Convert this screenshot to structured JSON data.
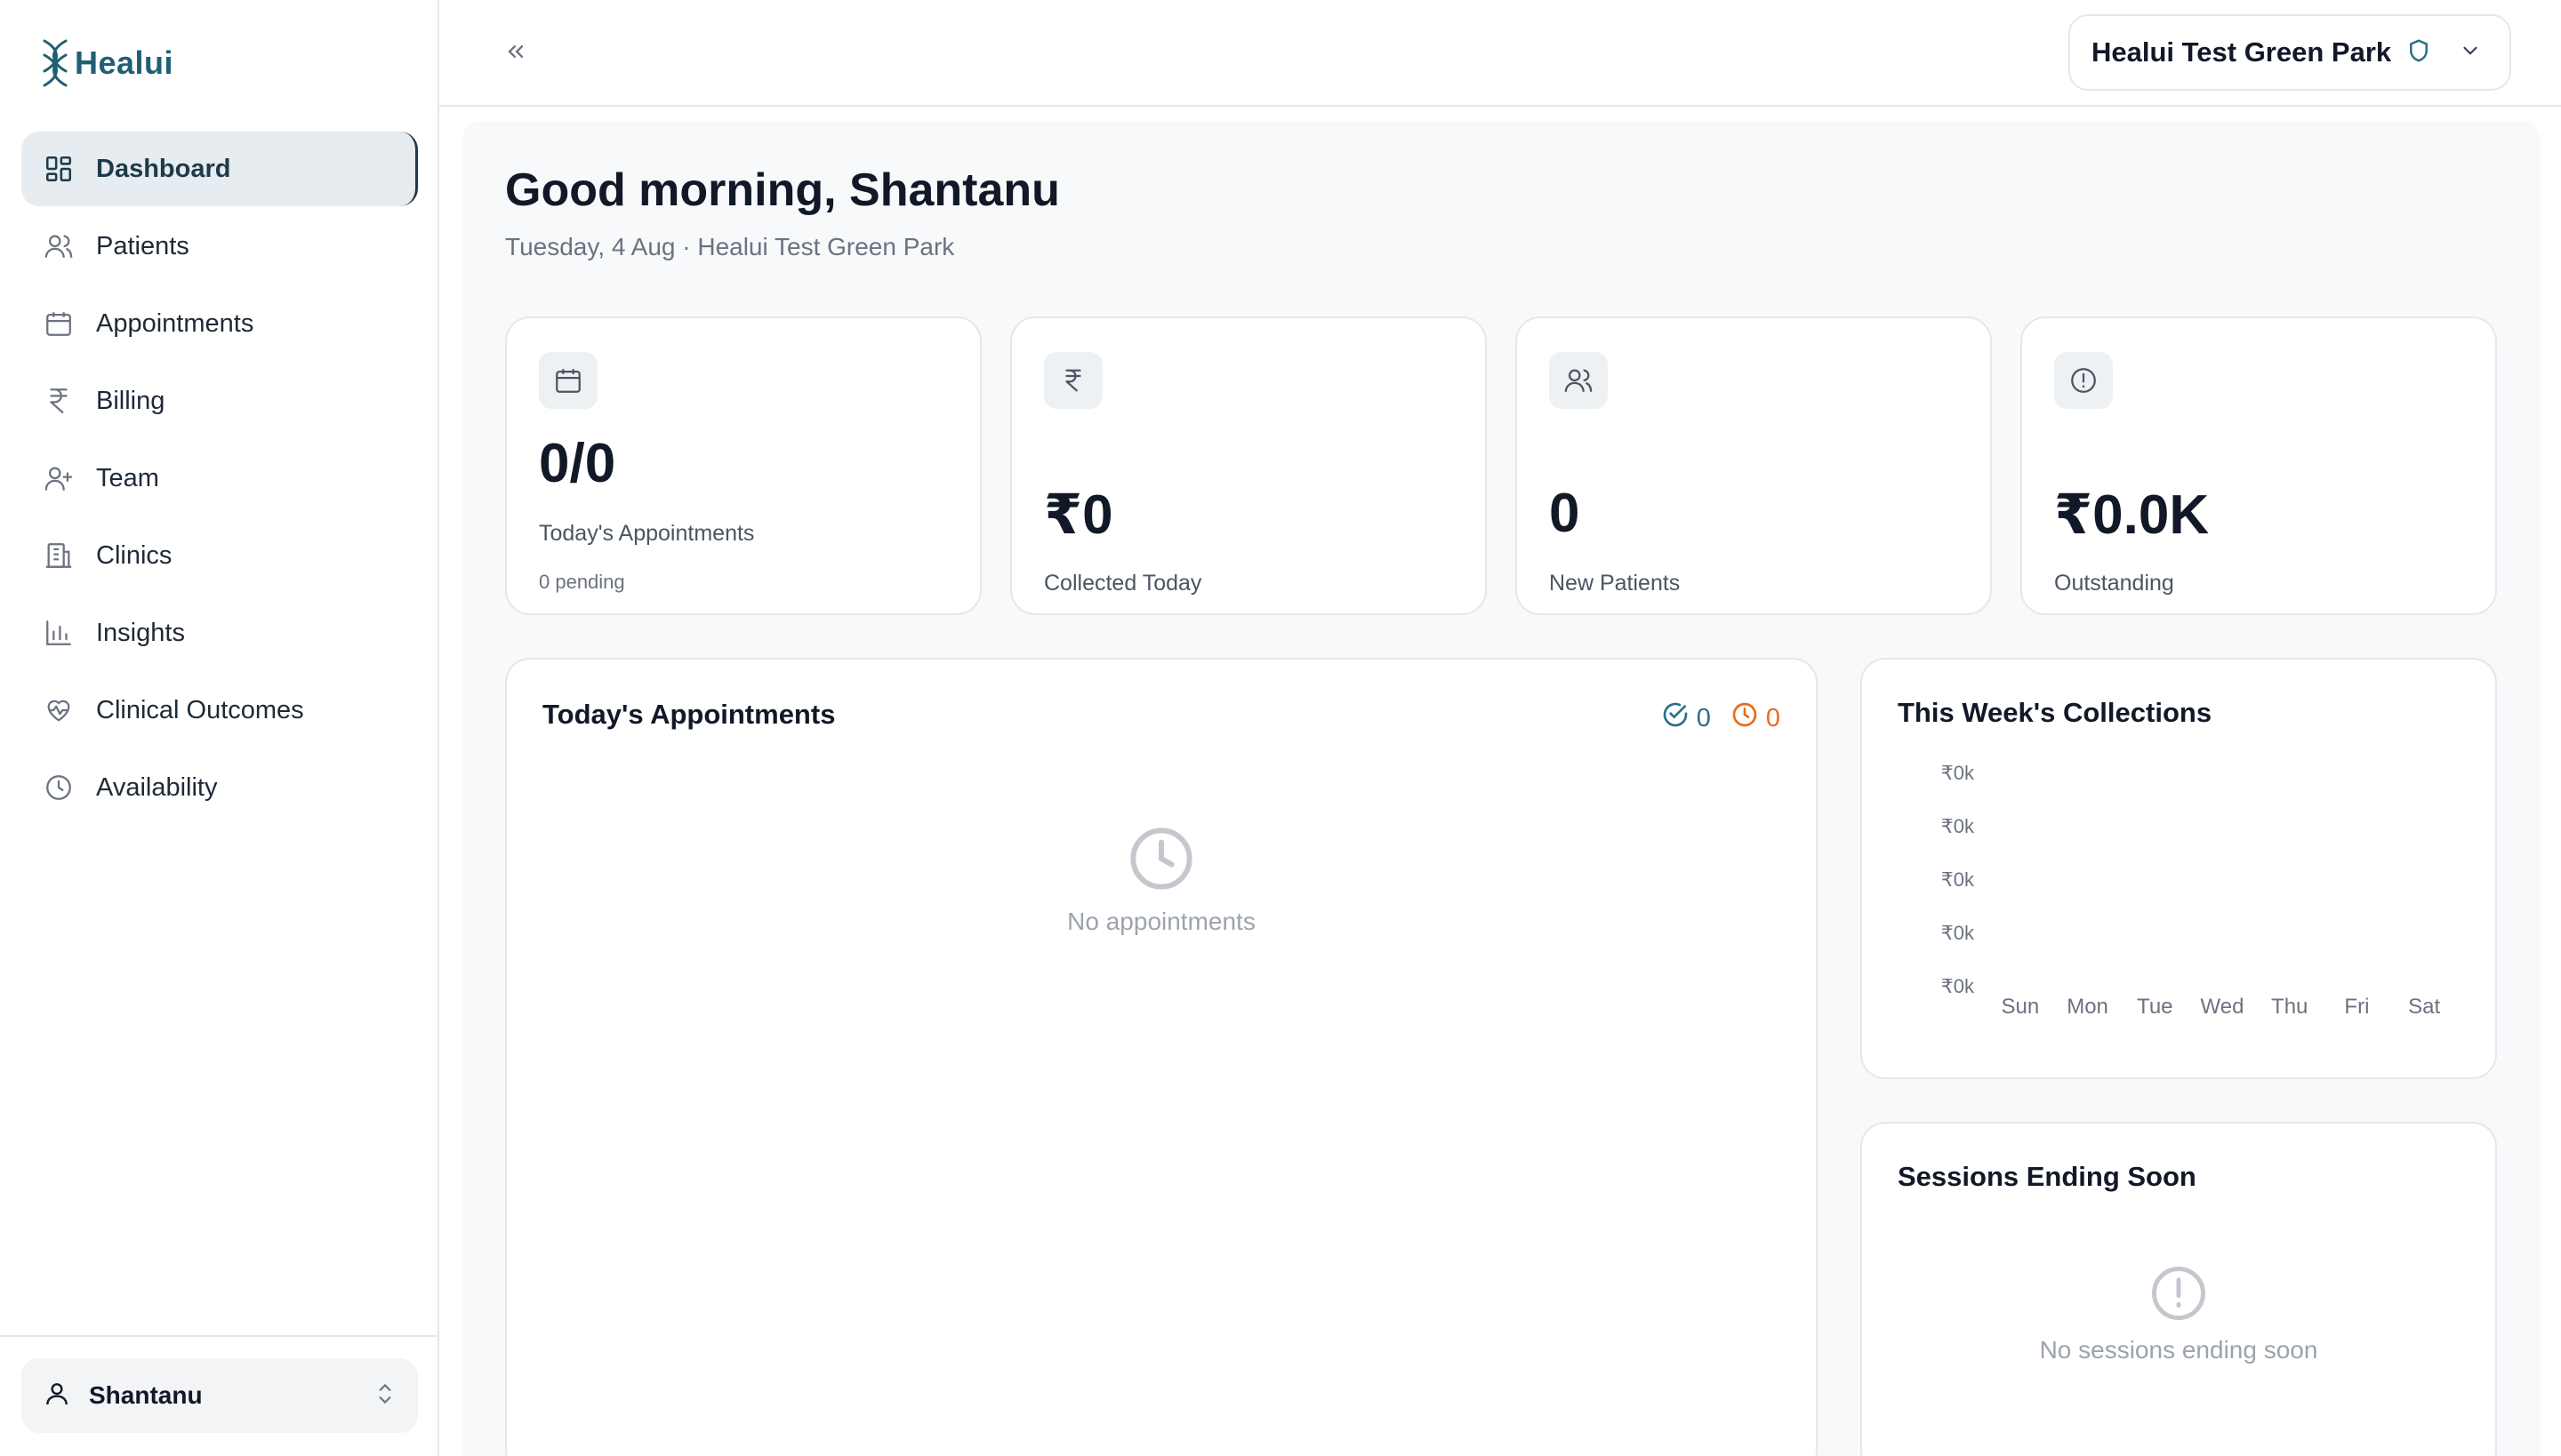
{
  "brand": {
    "name": "Healui"
  },
  "sidebar": {
    "items": [
      {
        "label": "Dashboard",
        "icon": "dashboard-icon",
        "active": true
      },
      {
        "label": "Patients",
        "icon": "users-icon"
      },
      {
        "label": "Appointments",
        "icon": "calendar-icon"
      },
      {
        "label": "Billing",
        "icon": "rupee-icon"
      },
      {
        "label": "Team",
        "icon": "user-plus-icon"
      },
      {
        "label": "Clinics",
        "icon": "building-icon"
      },
      {
        "label": "Insights",
        "icon": "bar-chart-icon"
      },
      {
        "label": "Clinical Outcomes",
        "icon": "heart-pulse-icon"
      },
      {
        "label": "Availability",
        "icon": "clock-icon"
      }
    ],
    "user": {
      "name": "Shantanu"
    }
  },
  "header": {
    "clinic_name": "Healui Test Green Park"
  },
  "main": {
    "greeting": "Good morning, Shantanu",
    "subtitle": "Tuesday, 4 Aug · Healui Test Green Park",
    "stats": [
      {
        "value": "0/0",
        "label": "Today's Appointments",
        "note": "0 pending",
        "icon": "calendar-icon"
      },
      {
        "value": "₹0",
        "label": "Collected Today",
        "icon": "rupee-icon"
      },
      {
        "value": "0",
        "label": "New Patients",
        "icon": "users-icon"
      },
      {
        "value": "₹0.0K",
        "label": "Outstanding",
        "icon": "alert-circle-icon"
      }
    ],
    "appointments": {
      "title": "Today's Appointments",
      "done_count": "0",
      "pending_count": "0",
      "empty_text": "No appointments"
    },
    "collections": {
      "title": "This Week's Collections"
    },
    "sessions": {
      "title": "Sessions Ending Soon",
      "empty_text": "No sessions ending soon"
    }
  },
  "colors": {
    "accent": "#1f5f73",
    "pending": "#ea6a1c",
    "done": "#2b6f8a"
  },
  "chart_data": {
    "type": "bar",
    "categories": [
      "Sun",
      "Mon",
      "Tue",
      "Wed",
      "Thu",
      "Fri",
      "Sat"
    ],
    "values": [
      0,
      0,
      0,
      0,
      0,
      0,
      0
    ],
    "y_ticks": [
      "₹0k",
      "₹0k",
      "₹0k",
      "₹0k",
      "₹0k"
    ],
    "title": "This Week's Collections",
    "xlabel": "",
    "ylabel": "",
    "grid": false
  }
}
